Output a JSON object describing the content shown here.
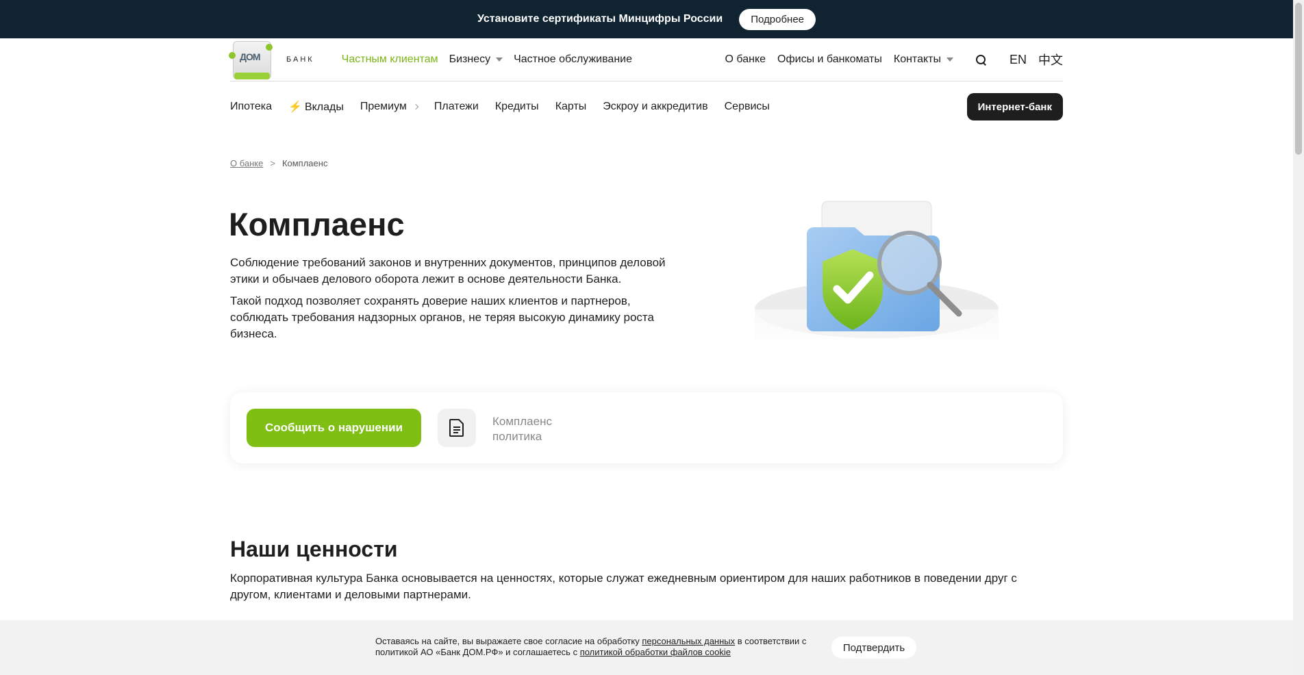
{
  "banner": {
    "text": "Установите сертификаты Минцифры России",
    "button": "Подробнее"
  },
  "logo": {
    "mark": "ДОМ",
    "word": "БАНК"
  },
  "header": {
    "nav": [
      {
        "label": "Частным клиентам",
        "active": true
      },
      {
        "label": "Бизнесу",
        "dropdown": true
      },
      {
        "label": "Частное обслуживание"
      }
    ],
    "right": {
      "about": "О банке",
      "offices": "Офисы и банкоматы",
      "contacts": "Контакты",
      "lang_en": "EN",
      "lang_zh": "中文"
    }
  },
  "subnav": {
    "items": [
      "Ипотека",
      "Вклады",
      "Премиум",
      "Платежи",
      "Кредиты",
      "Карты",
      "Эскроу и аккредитив",
      "Сервисы"
    ],
    "internet_bank": "Интернет-банк"
  },
  "breadcrumb": {
    "parent": "О банке",
    "separator": ">",
    "current": "Комплаенс"
  },
  "hero": {
    "title": "Комплаенс",
    "p1": "Соблюдение требований законов и внутренних документов, принципов деловой этики и обычаев делового оборота лежит в основе деятельности Банка.",
    "p2": "Такой подход позволяет сохранять доверие наших клиентов и партнеров, соблюдать требования надзорных органов, не теряя высокую динамику роста бизнеса."
  },
  "actions": {
    "report_button": "Сообщить о нарушении",
    "doc_line1": "Комплаенс",
    "doc_line2": "политика"
  },
  "values": {
    "title": "Наши ценности",
    "text": "Корпоративная культура Банка основывается на ценностях, которые служат ежедневным ориентиром для наших работников в поведении друг с другом, клиентами и деловыми партнерами."
  },
  "cookie": {
    "t1": "Оставаясь на сайте, вы выражаете свое согласие на обработку ",
    "link1": "персональных данных",
    "t2": " в соответствии с политикой АО «Банк ДОМ.РФ» и соглашаетесь с ",
    "link2": "политикой обработки файлов cookie",
    "button": "Подтвердить"
  },
  "colors": {
    "accent": "#7fbf14",
    "banner_bg": "#0f2330",
    "dark_button": "#1e1e1e"
  }
}
